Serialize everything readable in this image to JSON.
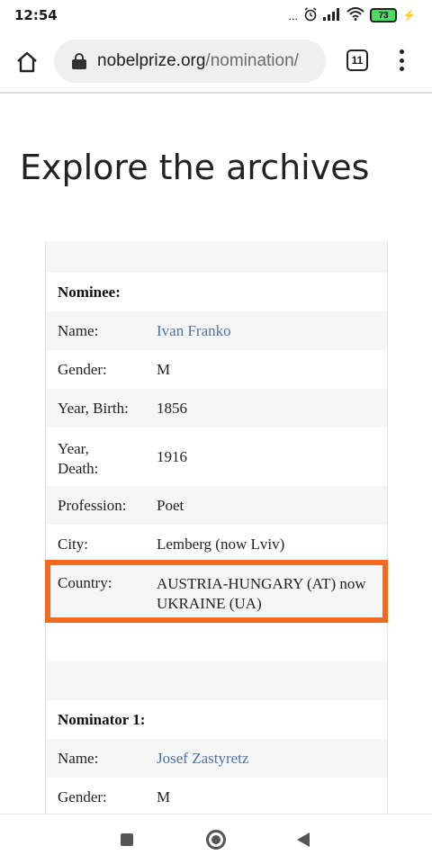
{
  "status_bar": {
    "time": "12:54",
    "dots": "...",
    "battery": "73"
  },
  "browser": {
    "url_host": "nobelprize.org",
    "url_path": "/nomination/",
    "tab_count": "11"
  },
  "page": {
    "title": "Explore the archives"
  },
  "nominee": {
    "heading": "Nominee:",
    "fields": [
      {
        "label": "Name:",
        "value": "Ivan Franko"
      },
      {
        "label": "Gender:",
        "value": "M"
      },
      {
        "label_line1": "Year, Birth:",
        "value": "1856"
      },
      {
        "label_line1": "Year,",
        "label_line2": "Death:",
        "value": "1916"
      },
      {
        "label": "Profession:",
        "value": "Poet"
      },
      {
        "label": "City:",
        "value": "Lemberg (now Lviv)"
      },
      {
        "label": "Country:",
        "value_line1": "AUSTRIA-HUNGARY (AT) now",
        "value_line2": "UKRAINE (UA)"
      }
    ]
  },
  "nominator": {
    "heading": "Nominator 1:",
    "fields": [
      {
        "label": "Name:",
        "value": "Josef Zastyretz"
      },
      {
        "label": "Gender:",
        "value": "M"
      }
    ]
  },
  "colors": {
    "link": "#4a74a8",
    "highlight": "#f26b1d",
    "row_shade": "#f6f6f6"
  }
}
